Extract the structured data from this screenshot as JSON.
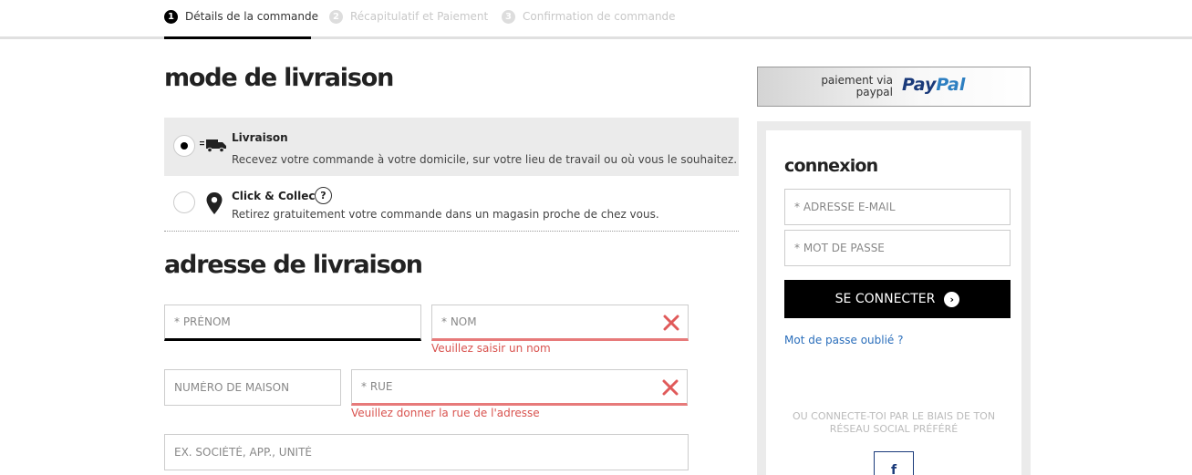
{
  "steps": [
    {
      "num": "1",
      "label": "Détails de la commande"
    },
    {
      "num": "2",
      "label": "Récapitulatif et Paiement"
    },
    {
      "num": "3",
      "label": "Confirmation de commande"
    }
  ],
  "delivery_mode": {
    "title": "mode de livraison",
    "options": [
      {
        "title": "Livraison",
        "description": "Recevez votre commande à votre domicile, sur votre lieu de travail ou où vous le souhaitez.",
        "selected": true,
        "icon": "truck-icon"
      },
      {
        "title": "Click & Collect",
        "description": "Retirez gratuitement votre commande dans un magasin proche de chez vous.",
        "selected": false,
        "icon": "location-pin-icon",
        "help": "?"
      }
    ]
  },
  "address": {
    "title": "adresse de livraison",
    "first_name": {
      "placeholder": "* PRÉNOM",
      "value": ""
    },
    "last_name": {
      "placeholder": "* NOM",
      "value": "",
      "error": "Veuillez saisir un nom"
    },
    "house_number": {
      "placeholder": "NUMÉRO DE MAISON",
      "value": ""
    },
    "street": {
      "placeholder": "* RUE",
      "value": "",
      "error": "Veuillez donner la rue de l'adresse"
    },
    "extra": {
      "placeholder": "EX. SOCIÉTÉ, APP., UNITÉ",
      "value": ""
    }
  },
  "paypal": {
    "line1": "paiement via",
    "line2": "paypal",
    "logo_part1": "Pay",
    "logo_part2": "Pal"
  },
  "login": {
    "title": "connexion",
    "email": {
      "placeholder": "* ADRESSE E-MAIL",
      "value": ""
    },
    "password": {
      "placeholder": "* MOT DE PASSE",
      "value": ""
    },
    "submit_label": "SE CONNECTER",
    "forgot_label": "Mot de passe oublié ?",
    "social_text": "OU CONNECTE-TOI PAR LE BIAIS DE TON RÉSEAU SOCIAL PRÉFÉRÉ",
    "facebook_label": "f"
  },
  "colors": {
    "error": "#e77a7a",
    "link": "#2a6ebb",
    "primary": "#000000"
  }
}
